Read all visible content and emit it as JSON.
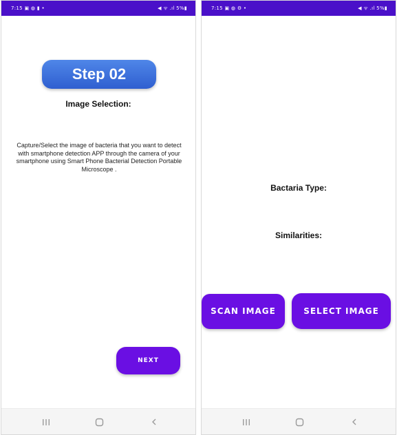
{
  "status_bar": {
    "left": {
      "time": "7:15",
      "indicators": "▣ ◍ ▮ •"
    },
    "right": {
      "time": "7:15",
      "indicators": "▣ ◍ ⚙ •"
    },
    "system_icons": "◀ ᯤ .ıl 5%▮",
    "background_color": "#4a10c9"
  },
  "screen_left": {
    "step_badge": "Step 02",
    "section_title": "Image Selection:",
    "instructions": "Capture/Select the image of bacteria that you want to detect with smartphone detection APP through the camera of your smartphone using Smart Phone Bacterial Detection Portable Microscope .",
    "next_button": "NEXT"
  },
  "screen_right": {
    "bacteria_type_label": "Bactaria Type:",
    "similarities_label": "Similarities:",
    "scan_button": "SCAN IMAGE",
    "select_button": "SELECT IMAGE"
  },
  "nav_bar": {
    "icons": [
      "recents-icon",
      "home-icon",
      "back-icon"
    ]
  },
  "colors": {
    "accent": "#6a0fe3",
    "step_badge_gradient": [
      "#4f86e8",
      "#2f5fd0"
    ],
    "status_bar": "#4a10c9"
  }
}
